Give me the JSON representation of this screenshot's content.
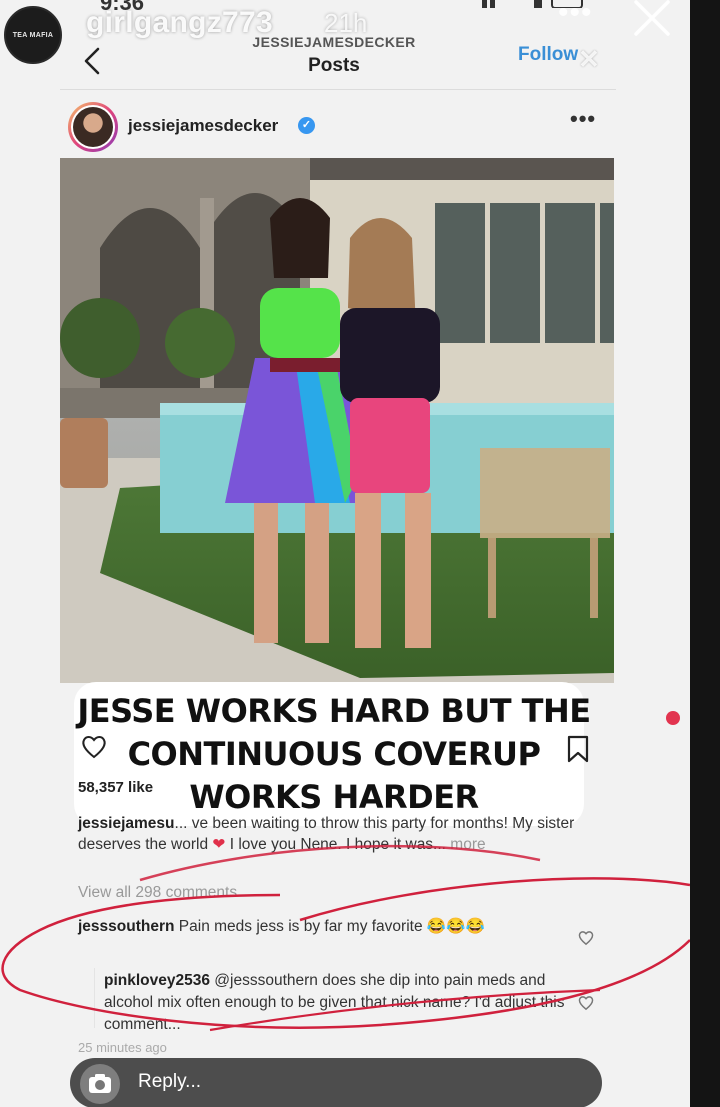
{
  "story": {
    "time": "9:36",
    "username": "girlgangz773",
    "age": "21h",
    "avatar_text": "TEA MAFIA",
    "more_icon": "ellipsis-icon",
    "close_icon": "close-icon"
  },
  "ig_header": {
    "subtitle": "JESSIEJAMESDECKER",
    "title": "Posts",
    "follow_label": "Follow",
    "back_icon": "chevron-left-icon"
  },
  "post": {
    "author": "jessiejamesdecker",
    "verified": true,
    "more_icon": "ellipsis-icon",
    "likes": "58,357 like",
    "caption_user": "jessiejamesu",
    "caption_fragment": "... ve  been waiting to throw this party for months! My sister deserves the world",
    "caption_cont": "I love you Nene. I hope it was...",
    "caption_more": "more",
    "view_all": "View all 298 comments",
    "time_ago": "25 minutes ago"
  },
  "overlay_caption": {
    "line1": "JESSE WORKS HARD BUT THE",
    "line2": "CONTINUOUS COVERUP",
    "line3": "WORKS HARDER"
  },
  "comments": [
    {
      "user": "jesssouthern",
      "text": "Pain meds jess is by far my favorite 😂😂😂"
    },
    {
      "user": "pinklovey2536",
      "text": "@jesssouthern does she dip into pain meds and alcohol mix often enough to be given that nick name? I'd adjust this comment..."
    }
  ],
  "reply": {
    "placeholder": "Reply...",
    "camera_icon": "camera-icon"
  },
  "colors": {
    "annotation_red": "#d0213d",
    "link_blue": "#3a8fd6",
    "verified_blue": "#3797f0"
  }
}
